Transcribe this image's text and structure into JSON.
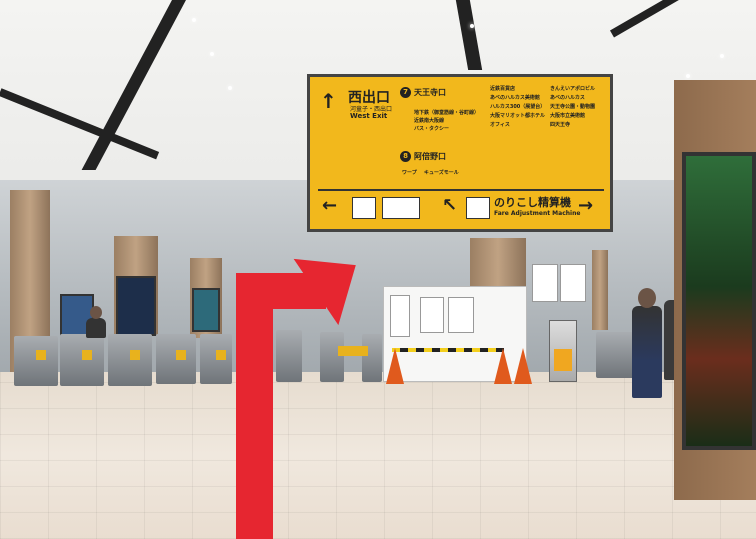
{
  "photo": {
    "sign": {
      "west_exit_ja": "西出口",
      "west_exit_en": "West Exit",
      "west_exit_sub": "河童子・西出口",
      "line7_num": "7",
      "line7_name": "天王寺口",
      "line7_items": [
        "地下鉄（御堂筋線・谷町線）",
        "近鉄南大阪線",
        "バス・タクシー"
      ],
      "line8_num": "8",
      "line8_name": "阿倍野口",
      "line8_items": [
        "ワープ",
        "キューズモール"
      ],
      "right_list": [
        "近鉄百貨店",
        "あべのハルカス美術館",
        "ハルカス300（展望台）",
        "大阪マリオット都ホテル",
        "オフィス",
        "きんえいアポロビル",
        "あべのハルカス",
        "天王寺公園・動物園",
        "大阪市立美術館",
        "四天王寺"
      ],
      "fare_adjustment_ja": "のりこし精算機",
      "fare_adjustment_en": "Fare Adjustment Machine",
      "arrow_left": "←",
      "arrow_right": "→",
      "arrow_up": "↑",
      "arrow_upleft": "↖"
    },
    "colors": {
      "sign_yellow": "#f2b81c",
      "guide_arrow_red": "#e62630",
      "cone_orange": "#e05a1d"
    }
  }
}
